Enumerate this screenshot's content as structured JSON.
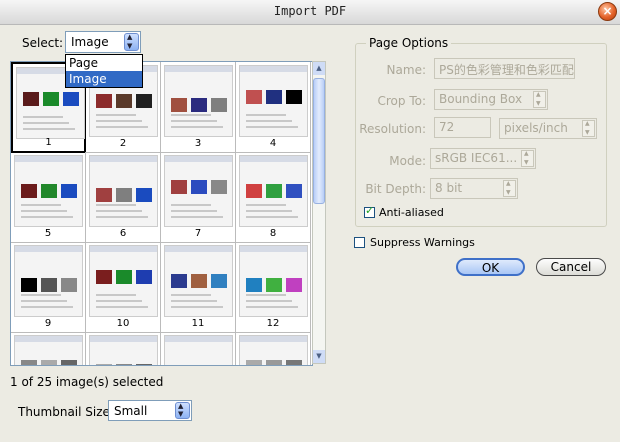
{
  "window": {
    "title": "Import PDF"
  },
  "select": {
    "label": "Select:",
    "value": "Image",
    "options": [
      "Page",
      "Image"
    ],
    "highlighted": "Image"
  },
  "thumbnails": [
    {
      "num": "1",
      "selected": true
    },
    {
      "num": "2"
    },
    {
      "num": "3"
    },
    {
      "num": "4"
    },
    {
      "num": "5"
    },
    {
      "num": "6"
    },
    {
      "num": "7"
    },
    {
      "num": "8"
    },
    {
      "num": "9"
    },
    {
      "num": "10"
    },
    {
      "num": "11"
    },
    {
      "num": "12"
    },
    {
      "num": ""
    },
    {
      "num": ""
    },
    {
      "num": ""
    },
    {
      "num": ""
    }
  ],
  "status": "1 of 25 image(s) selected",
  "thumbnail_size": {
    "label": "Thumbnail Size:",
    "value": "Small"
  },
  "page_options": {
    "title": "Page Options",
    "name_label": "Name:",
    "name_value": "PS的色彩管理和色彩匹配",
    "crop_label": "Crop To:",
    "crop_value": "Bounding Box",
    "resolution_label": "Resolution:",
    "resolution_value": "72",
    "resolution_unit": "pixels/inch",
    "mode_label": "Mode:",
    "mode_value": "sRGB IEC61...",
    "bitdepth_label": "Bit Depth:",
    "bitdepth_value": "8 bit",
    "antialiased_label": "Anti-aliased"
  },
  "suppress_label": "Suppress Warnings",
  "buttons": {
    "ok": "OK",
    "cancel": "Cancel"
  }
}
